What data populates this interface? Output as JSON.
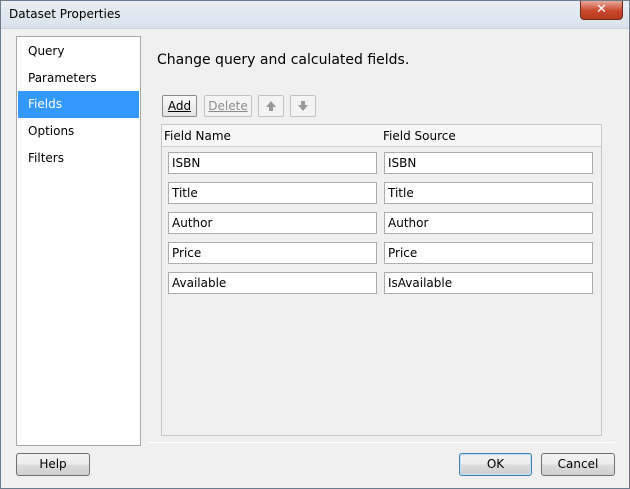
{
  "window": {
    "title": "Dataset Properties",
    "close_glyph": "✕"
  },
  "nav": {
    "items": [
      {
        "label": "Query",
        "selected": false
      },
      {
        "label": "Parameters",
        "selected": false
      },
      {
        "label": "Fields",
        "selected": true
      },
      {
        "label": "Options",
        "selected": false
      },
      {
        "label": "Filters",
        "selected": false
      }
    ]
  },
  "main": {
    "heading": "Change query and calculated fields.",
    "toolbar": {
      "add_label": "Add",
      "delete_label": "Delete",
      "move_up_icon": "arrow-up-icon",
      "move_down_icon": "arrow-down-icon"
    },
    "grid": {
      "columns": [
        "Field Name",
        "Field Source"
      ],
      "rows": [
        {
          "name": "ISBN",
          "source": "ISBN"
        },
        {
          "name": "Title",
          "source": "Title"
        },
        {
          "name": "Author",
          "source": "Author"
        },
        {
          "name": "Price",
          "source": "Price"
        },
        {
          "name": "Available",
          "source": "IsAvailable"
        }
      ]
    }
  },
  "footer": {
    "help_label": "Help",
    "ok_label": "OK",
    "cancel_label": "Cancel"
  }
}
